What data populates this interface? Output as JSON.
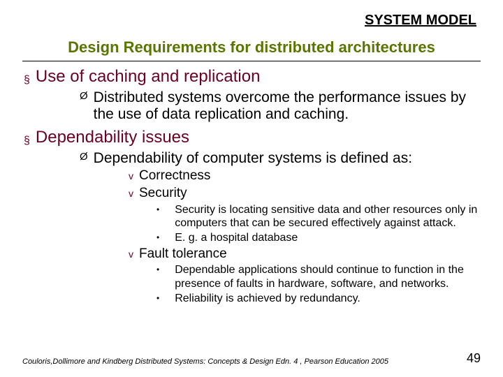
{
  "header": {
    "label": "SYSTEM MODEL"
  },
  "title": "Design Requirements for distributed architectures",
  "sections": {
    "s1": {
      "heading": "Use of caching and replication",
      "p1": "Distributed systems overcome the performance issues by the use of data replication and caching."
    },
    "s2": {
      "heading": "Dependability issues",
      "p1": "Dependability of computer systems is defined as:",
      "d1": "Correctness",
      "d2": "Security",
      "d2b1": "Security is locating sensitive data and other resources only in computers that can be secured effectively against attack.",
      "d2b2": "E. g. a hospital database",
      "d3": "Fault tolerance",
      "d3b1": "Dependable applications should continue to function in the presence of faults in hardware, software, and networks.",
      "d3b2": "Reliability is achieved by redundancy."
    }
  },
  "footer": {
    "citation": "Couloris,Dollimore and Kindberg  Distributed Systems: Concepts & Design  Edn. 4 ,  Pearson Education 2005",
    "page": "49"
  },
  "glyphs": {
    "square": "§",
    "triangle": "Ø",
    "diamond": "v",
    "dot": "•"
  }
}
